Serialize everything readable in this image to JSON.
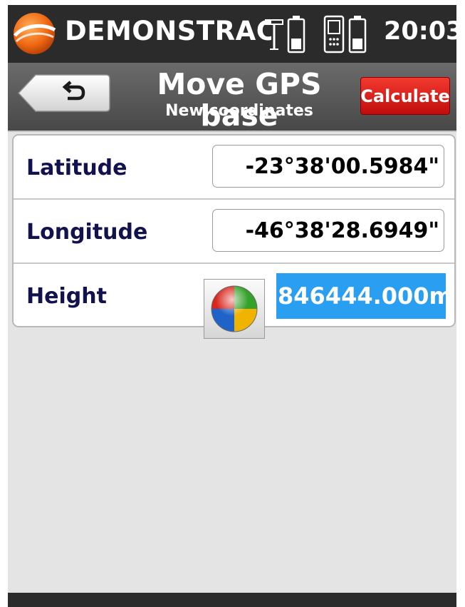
{
  "statusbar": {
    "app_name": "DEMONSTRAC/",
    "time": "20:03",
    "icons": [
      "app-logo-icon",
      "gps-antenna-icon",
      "battery-icon",
      "device-icon",
      "battery-icon"
    ]
  },
  "titlebar": {
    "back_icon": "undo-arrow-icon",
    "title": "Move GPS base",
    "subtitle": "New coordinates",
    "calculate_label": "Calculate"
  },
  "form": {
    "latitude": {
      "label": "Latitude",
      "value": "-23°38'00.5984\""
    },
    "longitude": {
      "label": "Longitude",
      "value": "-46°38'28.6949\""
    },
    "height": {
      "label": "Height",
      "value": "846444.000m",
      "unit_icon": "color-wheel-icon"
    }
  },
  "colors": {
    "accent_selection": "#2a9ef0",
    "calculate_red": "#d8201a",
    "label_navy": "#12124f",
    "background": "#e4e4e4"
  }
}
